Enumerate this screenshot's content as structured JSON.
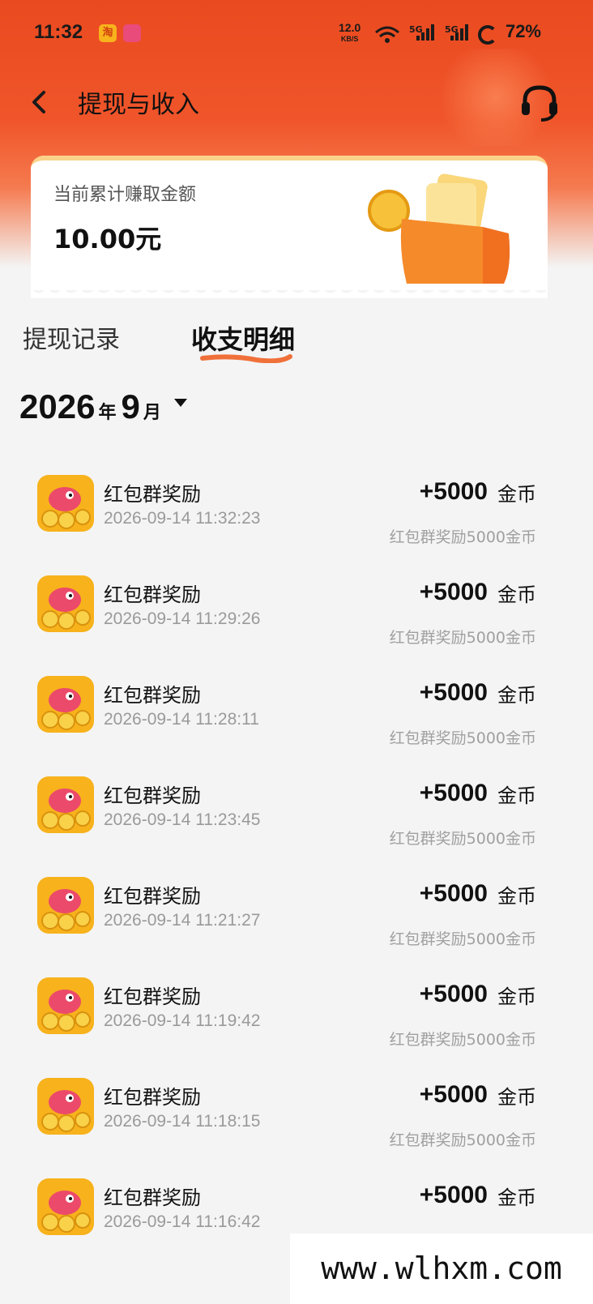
{
  "status_bar": {
    "time": "11:32",
    "net_speed_value": "12.0",
    "net_speed_unit": "KB/S",
    "signal_1": "5G",
    "signal_2": "5G",
    "battery": "72%",
    "app_icon_1": "淘"
  },
  "nav": {
    "title": "提现与收入",
    "back_icon": "chevron-left-icon",
    "service_icon": "headset-icon"
  },
  "earnings": {
    "label": "当前累计赚取金额",
    "amount": "10.00元"
  },
  "tabs": [
    {
      "label": "提现记录",
      "active": false
    },
    {
      "label": "收支明细",
      "active": true
    }
  ],
  "month_picker": {
    "year": "2026",
    "year_unit": "年",
    "month": "9",
    "month_unit": "月"
  },
  "records": [
    {
      "title": "红包群奖励",
      "time": "2026-09-14 11:32:23",
      "amount": "+5000",
      "unit": "金币",
      "desc": "红包群奖励5000金币"
    },
    {
      "title": "红包群奖励",
      "time": "2026-09-14 11:29:26",
      "amount": "+5000",
      "unit": "金币",
      "desc": "红包群奖励5000金币"
    },
    {
      "title": "红包群奖励",
      "time": "2026-09-14 11:28:11",
      "amount": "+5000",
      "unit": "金币",
      "desc": "红包群奖励5000金币"
    },
    {
      "title": "红包群奖励",
      "time": "2026-09-14 11:23:45",
      "amount": "+5000",
      "unit": "金币",
      "desc": "红包群奖励5000金币"
    },
    {
      "title": "红包群奖励",
      "time": "2026-09-14 11:21:27",
      "amount": "+5000",
      "unit": "金币",
      "desc": "红包群奖励5000金币"
    },
    {
      "title": "红包群奖励",
      "time": "2026-09-14 11:19:42",
      "amount": "+5000",
      "unit": "金币",
      "desc": "红包群奖励5000金币"
    },
    {
      "title": "红包群奖励",
      "time": "2026-09-14 11:18:15",
      "amount": "+5000",
      "unit": "金币",
      "desc": "红包群奖励5000金币"
    },
    {
      "title": "红包群奖励",
      "time": "2026-09-14 11:16:42",
      "amount": "+5000",
      "unit": "金币",
      "desc": ""
    }
  ],
  "watermark": "www.wlhxm.com",
  "colors": {
    "brand": "#ea4a1f",
    "tab_underline": "#f0703a",
    "coin": "#f7b21c"
  }
}
